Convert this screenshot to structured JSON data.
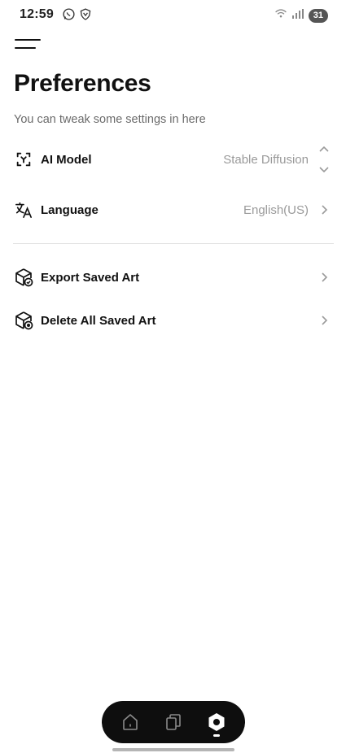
{
  "status_bar": {
    "time": "12:59",
    "battery": "31",
    "icons_left": [
      "whatsapp-icon",
      "vpn-shield-icon"
    ],
    "icons_right": [
      "wifi-icon",
      "signal-icon",
      "battery-icon"
    ]
  },
  "header": {
    "menu_icon": "hamburger-menu-icon",
    "title": "Preferences",
    "subtitle": "You can tweak some settings in here"
  },
  "settings": {
    "ai_model": {
      "label": "AI Model",
      "value": "Stable Diffusion",
      "icon": "ai-model-icon"
    },
    "language": {
      "label": "Language",
      "value": "English(US)",
      "icon": "translate-icon"
    },
    "export": {
      "label": "Export Saved Art",
      "icon": "box-check-icon"
    },
    "delete": {
      "label": "Delete All Saved Art",
      "icon": "box-delete-icon"
    }
  },
  "bottom_nav": {
    "items": [
      {
        "name": "home",
        "icon": "home-icon",
        "active": false
      },
      {
        "name": "gallery",
        "icon": "gallery-icon",
        "active": false
      },
      {
        "name": "settings",
        "icon": "settings-hex-icon",
        "active": true
      }
    ]
  },
  "colors": {
    "background": "#ffffff",
    "text": "#111111",
    "muted": "#9a9a9a",
    "subtitle": "#6b6b6b",
    "nav_bg": "#0e0e0e"
  }
}
